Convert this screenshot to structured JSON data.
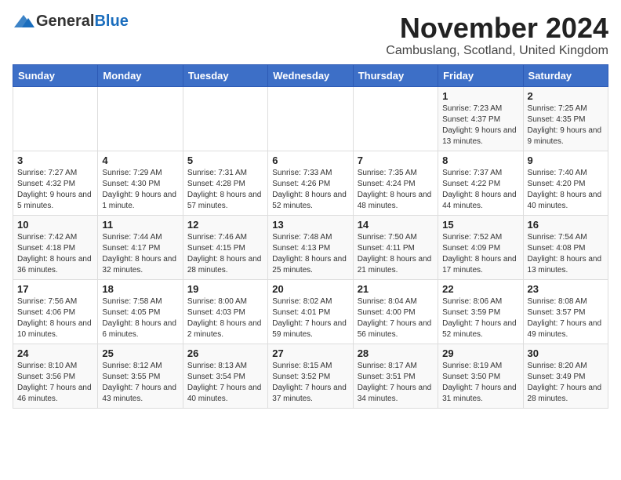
{
  "logo": {
    "general": "General",
    "blue": "Blue"
  },
  "title": "November 2024",
  "subtitle": "Cambuslang, Scotland, United Kingdom",
  "days_of_week": [
    "Sunday",
    "Monday",
    "Tuesday",
    "Wednesday",
    "Thursday",
    "Friday",
    "Saturday"
  ],
  "weeks": [
    [
      {
        "day": "",
        "info": ""
      },
      {
        "day": "",
        "info": ""
      },
      {
        "day": "",
        "info": ""
      },
      {
        "day": "",
        "info": ""
      },
      {
        "day": "",
        "info": ""
      },
      {
        "day": "1",
        "info": "Sunrise: 7:23 AM\nSunset: 4:37 PM\nDaylight: 9 hours and 13 minutes."
      },
      {
        "day": "2",
        "info": "Sunrise: 7:25 AM\nSunset: 4:35 PM\nDaylight: 9 hours and 9 minutes."
      }
    ],
    [
      {
        "day": "3",
        "info": "Sunrise: 7:27 AM\nSunset: 4:32 PM\nDaylight: 9 hours and 5 minutes."
      },
      {
        "day": "4",
        "info": "Sunrise: 7:29 AM\nSunset: 4:30 PM\nDaylight: 9 hours and 1 minute."
      },
      {
        "day": "5",
        "info": "Sunrise: 7:31 AM\nSunset: 4:28 PM\nDaylight: 8 hours and 57 minutes."
      },
      {
        "day": "6",
        "info": "Sunrise: 7:33 AM\nSunset: 4:26 PM\nDaylight: 8 hours and 52 minutes."
      },
      {
        "day": "7",
        "info": "Sunrise: 7:35 AM\nSunset: 4:24 PM\nDaylight: 8 hours and 48 minutes."
      },
      {
        "day": "8",
        "info": "Sunrise: 7:37 AM\nSunset: 4:22 PM\nDaylight: 8 hours and 44 minutes."
      },
      {
        "day": "9",
        "info": "Sunrise: 7:40 AM\nSunset: 4:20 PM\nDaylight: 8 hours and 40 minutes."
      }
    ],
    [
      {
        "day": "10",
        "info": "Sunrise: 7:42 AM\nSunset: 4:18 PM\nDaylight: 8 hours and 36 minutes."
      },
      {
        "day": "11",
        "info": "Sunrise: 7:44 AM\nSunset: 4:17 PM\nDaylight: 8 hours and 32 minutes."
      },
      {
        "day": "12",
        "info": "Sunrise: 7:46 AM\nSunset: 4:15 PM\nDaylight: 8 hours and 28 minutes."
      },
      {
        "day": "13",
        "info": "Sunrise: 7:48 AM\nSunset: 4:13 PM\nDaylight: 8 hours and 25 minutes."
      },
      {
        "day": "14",
        "info": "Sunrise: 7:50 AM\nSunset: 4:11 PM\nDaylight: 8 hours and 21 minutes."
      },
      {
        "day": "15",
        "info": "Sunrise: 7:52 AM\nSunset: 4:09 PM\nDaylight: 8 hours and 17 minutes."
      },
      {
        "day": "16",
        "info": "Sunrise: 7:54 AM\nSunset: 4:08 PM\nDaylight: 8 hours and 13 minutes."
      }
    ],
    [
      {
        "day": "17",
        "info": "Sunrise: 7:56 AM\nSunset: 4:06 PM\nDaylight: 8 hours and 10 minutes."
      },
      {
        "day": "18",
        "info": "Sunrise: 7:58 AM\nSunset: 4:05 PM\nDaylight: 8 hours and 6 minutes."
      },
      {
        "day": "19",
        "info": "Sunrise: 8:00 AM\nSunset: 4:03 PM\nDaylight: 8 hours and 2 minutes."
      },
      {
        "day": "20",
        "info": "Sunrise: 8:02 AM\nSunset: 4:01 PM\nDaylight: 7 hours and 59 minutes."
      },
      {
        "day": "21",
        "info": "Sunrise: 8:04 AM\nSunset: 4:00 PM\nDaylight: 7 hours and 56 minutes."
      },
      {
        "day": "22",
        "info": "Sunrise: 8:06 AM\nSunset: 3:59 PM\nDaylight: 7 hours and 52 minutes."
      },
      {
        "day": "23",
        "info": "Sunrise: 8:08 AM\nSunset: 3:57 PM\nDaylight: 7 hours and 49 minutes."
      }
    ],
    [
      {
        "day": "24",
        "info": "Sunrise: 8:10 AM\nSunset: 3:56 PM\nDaylight: 7 hours and 46 minutes."
      },
      {
        "day": "25",
        "info": "Sunrise: 8:12 AM\nSunset: 3:55 PM\nDaylight: 7 hours and 43 minutes."
      },
      {
        "day": "26",
        "info": "Sunrise: 8:13 AM\nSunset: 3:54 PM\nDaylight: 7 hours and 40 minutes."
      },
      {
        "day": "27",
        "info": "Sunrise: 8:15 AM\nSunset: 3:52 PM\nDaylight: 7 hours and 37 minutes."
      },
      {
        "day": "28",
        "info": "Sunrise: 8:17 AM\nSunset: 3:51 PM\nDaylight: 7 hours and 34 minutes."
      },
      {
        "day": "29",
        "info": "Sunrise: 8:19 AM\nSunset: 3:50 PM\nDaylight: 7 hours and 31 minutes."
      },
      {
        "day": "30",
        "info": "Sunrise: 8:20 AM\nSunset: 3:49 PM\nDaylight: 7 hours and 28 minutes."
      }
    ]
  ]
}
